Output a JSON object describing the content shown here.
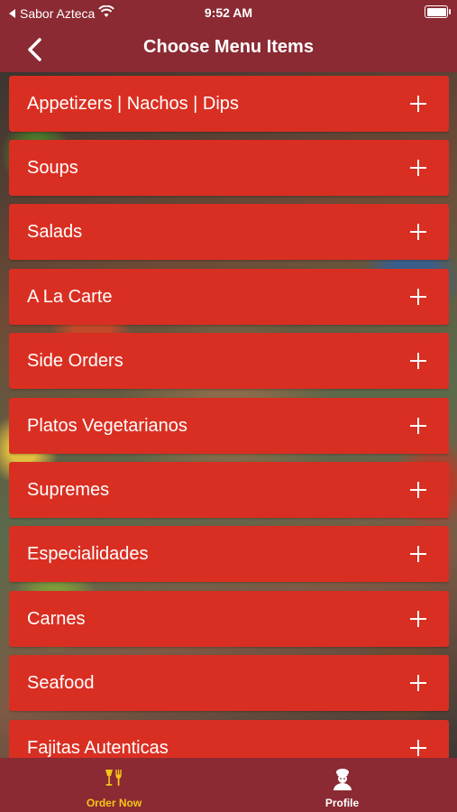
{
  "status_bar": {
    "carrier": "Sabor Azteca",
    "time": "9:52 AM"
  },
  "nav": {
    "title": "Choose Menu Items"
  },
  "menu_items": [
    {
      "label": "Appetizers | Nachos | Dips"
    },
    {
      "label": "Soups"
    },
    {
      "label": "Salads"
    },
    {
      "label": "A La Carte"
    },
    {
      "label": "Side Orders"
    },
    {
      "label": "Platos Vegetarianos"
    },
    {
      "label": "Supremes"
    },
    {
      "label": "Especialidades"
    },
    {
      "label": "Carnes"
    },
    {
      "label": "Seafood"
    },
    {
      "label": "Fajitas Autenticas"
    }
  ],
  "tab_bar": {
    "tabs": [
      {
        "label": "Order Now",
        "icon": "food-drink-icon",
        "active": true
      },
      {
        "label": "Profile",
        "icon": "chef-profile-icon",
        "active": false
      }
    ]
  },
  "colors": {
    "header": "#8b2a33",
    "item": "#d92f22",
    "active_tab": "#f5c518",
    "inactive_tab": "#ffffff"
  }
}
